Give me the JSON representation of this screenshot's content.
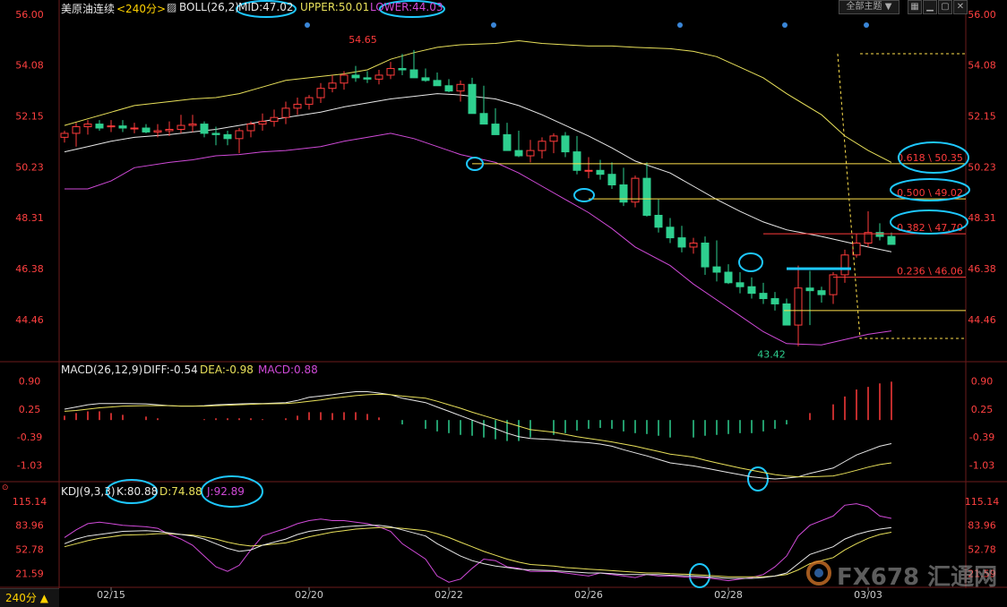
{
  "colors": {
    "bg": "#000000",
    "up": "#ff3b3b",
    "down": "#2ecf8f",
    "price_axis": "#ff4040",
    "mid": "#e8e8e8",
    "upper": "#e8e05a",
    "lower": "#d04ad8",
    "fib": "#ffe14d",
    "highlight": "#1ec8ff",
    "neutral_axis": "#cccccc"
  },
  "header": {
    "instrument": "美原油连续",
    "timeframe": "<240分>",
    "indicator": "BOLL(26,2)",
    "mid_label": "MID:47.02",
    "upper_label": "UPPER:50.01",
    "lower_label": "LOWER:44.03"
  },
  "toolbar": {
    "theme_label": "全部主题",
    "theme_arrow": "▼"
  },
  "timeframe_button": "240分 ▲",
  "watermark": "FX678 汇通网",
  "chart_data": [
    {
      "type": "candlestick",
      "panel": "price",
      "ylim": [
        43.0,
        56.0
      ],
      "y_ticks": [
        "56.00",
        "54.08",
        "52.15",
        "50.23",
        "48.31",
        "46.38",
        "44.46"
      ],
      "x_tick_labels": [
        "02/15",
        "02/20",
        "02/22",
        "02/26",
        "02/28",
        "03/03"
      ],
      "x_tick_index": [
        4,
        21,
        33,
        45,
        57,
        69
      ],
      "bar_count": 72,
      "candles": {
        "open": [
          51.35,
          51.5,
          51.75,
          51.85,
          51.75,
          51.78,
          51.7,
          51.7,
          51.55,
          51.6,
          51.65,
          51.8,
          51.85,
          51.5,
          51.45,
          51.3,
          51.6,
          51.85,
          51.95,
          52.1,
          52.45,
          52.6,
          52.85,
          53.2,
          53.4,
          53.7,
          53.6,
          53.55,
          53.7,
          53.95,
          53.9,
          53.6,
          53.5,
          53.3,
          53.1,
          53.35,
          52.25,
          51.85,
          51.45,
          50.85,
          50.65,
          50.85,
          51.2,
          51.4,
          50.8,
          50.1,
          50.1,
          49.95,
          49.55,
          48.9,
          49.8,
          48.4,
          47.95,
          47.55,
          47.2,
          47.35,
          46.45,
          46.25,
          45.85,
          45.7,
          45.45,
          45.25,
          45.05,
          44.25,
          45.65,
          45.55,
          45.4,
          46.15,
          46.9,
          47.35,
          47.75,
          47.6
        ],
        "high": [
          51.6,
          51.9,
          52.0,
          52.0,
          52.0,
          52.0,
          51.9,
          51.85,
          51.85,
          51.95,
          52.2,
          52.2,
          51.95,
          51.75,
          51.6,
          51.7,
          51.95,
          52.25,
          52.4,
          52.7,
          52.85,
          52.95,
          53.4,
          53.7,
          53.85,
          54.05,
          53.85,
          53.9,
          54.2,
          54.5,
          54.65,
          53.95,
          53.8,
          53.55,
          53.5,
          53.6,
          53.3,
          52.45,
          51.9,
          51.6,
          51.25,
          51.35,
          51.5,
          51.55,
          51.4,
          50.6,
          50.5,
          50.4,
          50.2,
          49.9,
          50.4,
          49.0,
          48.3,
          48.0,
          47.55,
          47.6,
          47.45,
          46.55,
          46.25,
          46.05,
          45.85,
          45.5,
          45.25,
          46.5,
          46.3,
          45.7,
          46.25,
          47.1,
          47.7,
          48.55,
          48.1,
          47.75
        ],
        "low": [
          51.15,
          51.0,
          51.45,
          51.6,
          51.55,
          51.55,
          51.5,
          51.5,
          51.35,
          51.4,
          51.5,
          51.55,
          51.35,
          51.05,
          51.05,
          50.75,
          51.35,
          51.6,
          51.75,
          51.85,
          52.2,
          52.4,
          52.65,
          53.05,
          53.15,
          53.45,
          53.4,
          53.35,
          53.55,
          53.7,
          53.75,
          53.45,
          53.3,
          53.05,
          52.7,
          52.85,
          52.15,
          51.6,
          51.15,
          50.6,
          50.4,
          50.55,
          50.75,
          50.6,
          49.95,
          49.8,
          49.75,
          49.4,
          48.75,
          48.7,
          48.35,
          47.75,
          47.35,
          47.0,
          46.95,
          46.15,
          45.9,
          45.8,
          45.45,
          45.25,
          45.05,
          44.8,
          44.6,
          43.45,
          44.25,
          45.1,
          45.05,
          45.85,
          46.8,
          47.2,
          47.45,
          47.3
        ],
        "close": [
          51.5,
          51.75,
          51.85,
          51.7,
          51.78,
          51.7,
          51.7,
          51.55,
          51.6,
          51.65,
          51.8,
          51.85,
          51.5,
          51.45,
          51.3,
          51.6,
          51.85,
          51.95,
          52.1,
          52.45,
          52.6,
          52.85,
          53.2,
          53.4,
          53.7,
          53.6,
          53.55,
          53.7,
          53.95,
          53.9,
          53.6,
          53.5,
          53.3,
          53.1,
          53.35,
          52.25,
          51.85,
          51.45,
          50.85,
          50.65,
          50.85,
          51.2,
          51.4,
          50.8,
          50.1,
          50.1,
          49.95,
          49.55,
          48.9,
          49.8,
          48.4,
          47.95,
          47.55,
          47.2,
          47.35,
          46.45,
          46.25,
          45.85,
          45.7,
          45.45,
          45.25,
          45.05,
          44.25,
          45.65,
          45.55,
          45.4,
          46.15,
          46.9,
          47.35,
          47.75,
          47.6,
          47.3
        ]
      },
      "bands": {
        "upper_start": [
          51.8,
          52.05,
          52.3,
          52.55,
          52.7,
          52.8,
          52.85,
          53.0,
          53.25,
          53.5,
          53.65,
          53.75,
          53.9,
          54.3,
          54.55,
          54.75,
          54.85,
          54.9,
          55.0,
          54.9,
          54.85,
          54.8,
          54.8,
          54.75,
          54.7,
          54.6,
          54.4,
          54.0,
          53.6,
          53.0,
          52.2,
          51.4,
          50.85,
          50.4
        ],
        "mid": [
          50.8,
          51.0,
          51.2,
          51.35,
          51.45,
          51.55,
          51.65,
          51.8,
          51.95,
          52.1,
          52.3,
          52.5,
          52.65,
          52.8,
          52.9,
          53.0,
          52.95,
          52.8,
          52.55,
          52.2,
          51.8,
          51.4,
          50.95,
          50.45,
          50.0,
          49.5,
          49.0,
          48.55,
          48.15,
          47.85,
          47.6,
          47.4,
          47.2,
          47.02
        ],
        "lower": [
          49.4,
          49.4,
          49.7,
          50.2,
          50.4,
          50.5,
          50.65,
          50.7,
          50.8,
          50.85,
          51.0,
          51.2,
          51.35,
          51.5,
          51.3,
          51.0,
          50.7,
          50.4,
          50.0,
          49.5,
          49.0,
          48.5,
          47.9,
          47.2,
          46.5,
          45.8,
          45.2,
          44.6,
          44.0,
          43.55,
          43.5,
          43.7,
          43.9,
          44.03
        ]
      },
      "annotations": {
        "high_label": "54.65",
        "high_value": 54.65,
        "low_label": "43.42",
        "low_value": 43.42,
        "fib_levels": [
          {
            "label": "0.618 \\ 50.35",
            "value": 50.35
          },
          {
            "label": "0.500 \\ 49.02",
            "value": 49.02
          },
          {
            "label": "0.382 \\ 47.70",
            "value": 47.7
          },
          {
            "label": "0.236 \\ 46.06",
            "value": 46.06
          }
        ],
        "support_line": 46.38,
        "lower_line": 44.8
      }
    },
    {
      "type": "macd",
      "panel": "macd",
      "title": "MACD(26,12,9)",
      "diff_label": "DIFF:-0.54",
      "dea_label": "DEA:-0.98",
      "macd_label": "MACD:0.88",
      "ylim": [
        -1.35,
        1.05
      ],
      "y_ticks": [
        "0.90",
        "0.25",
        "-0.39",
        "-1.03"
      ],
      "diff": [
        0.25,
        0.3,
        0.35,
        0.38,
        0.38,
        0.38,
        0.37,
        0.35,
        0.33,
        0.32,
        0.32,
        0.33,
        0.35,
        0.36,
        0.37,
        0.38,
        0.38,
        0.4,
        0.45,
        0.52,
        0.55,
        0.58,
        0.62,
        0.65,
        0.65,
        0.62,
        0.58,
        0.5,
        0.4,
        0.3,
        0.2,
        0.1,
        0.0,
        -0.1,
        -0.2,
        -0.3,
        -0.38,
        -0.42,
        -0.45,
        -0.48,
        -0.5,
        -0.52,
        -0.55,
        -0.6,
        -0.68,
        -0.75,
        -0.82,
        -0.9,
        -0.98,
        -1.05,
        -1.1,
        -1.15,
        -1.2,
        -1.25,
        -1.3,
        -1.33,
        -1.35,
        -1.33,
        -1.3,
        -1.22,
        -1.1,
        -0.95,
        -0.8,
        -0.7,
        -0.6,
        -0.54
      ],
      "dea": [
        0.2,
        0.22,
        0.25,
        0.28,
        0.3,
        0.32,
        0.33,
        0.33,
        0.33,
        0.32,
        0.32,
        0.32,
        0.33,
        0.34,
        0.35,
        0.36,
        0.37,
        0.38,
        0.4,
        0.43,
        0.46,
        0.5,
        0.53,
        0.56,
        0.58,
        0.59,
        0.58,
        0.55,
        0.5,
        0.43,
        0.35,
        0.27,
        0.18,
        0.1,
        0.02,
        -0.06,
        -0.14,
        -0.22,
        -0.28,
        -0.33,
        -0.38,
        -0.42,
        -0.46,
        -0.5,
        -0.55,
        -0.6,
        -0.66,
        -0.72,
        -0.78,
        -0.85,
        -0.92,
        -0.98,
        -1.04,
        -1.1,
        -1.15,
        -1.2,
        -1.25,
        -1.28,
        -1.3,
        -1.3,
        -1.28,
        -1.22,
        -1.15,
        -1.08,
        -1.02,
        -0.98
      ]
    },
    {
      "type": "kdj",
      "panel": "kdj",
      "title": "KDJ(9,3,3)",
      "k_label": "K:80.88",
      "d_label": "D:74.88",
      "j_label": "J:92.89",
      "ylim": [
        8.0,
        122.0
      ],
      "y_ticks": [
        "115.14",
        "83.96",
        "52.78",
        "21.59"
      ],
      "k": [
        60,
        66,
        70,
        72,
        74,
        76,
        77,
        76,
        74,
        72,
        70,
        66,
        60,
        54,
        50,
        52,
        58,
        66,
        72,
        76,
        78,
        80,
        82,
        83,
        84,
        84,
        82,
        78,
        70,
        60,
        52,
        44,
        38,
        34,
        31,
        29,
        27,
        26,
        25,
        24,
        23,
        22,
        22,
        21,
        20,
        20,
        20,
        20,
        19,
        18,
        17,
        16,
        15,
        15,
        15,
        16,
        18,
        22,
        34,
        46,
        56,
        66,
        72,
        76,
        79,
        80.88
      ],
      "d": [
        56,
        60,
        64,
        67,
        69,
        71,
        72,
        73,
        73,
        72,
        71,
        69,
        66,
        62,
        59,
        57,
        58,
        61,
        65,
        69,
        72,
        75,
        77,
        79,
        80,
        81,
        81,
        80,
        77,
        73,
        68,
        62,
        56,
        50,
        45,
        40,
        36,
        33,
        31,
        29,
        28,
        27,
        26,
        25,
        24,
        23,
        22,
        22,
        21,
        20,
        19,
        18,
        17,
        17,
        17,
        17,
        18,
        20,
        26,
        34,
        42,
        52,
        60,
        67,
        72,
        74.88
      ],
      "j": [
        68,
        78,
        86,
        88,
        86,
        84,
        82,
        80,
        72,
        66,
        58,
        44,
        30,
        24,
        32,
        52,
        70,
        80,
        86,
        90,
        92,
        90,
        90,
        88,
        86,
        82,
        76,
        60,
        40,
        18,
        10,
        14,
        28,
        40,
        38,
        30,
        28,
        24,
        24,
        22,
        20,
        18,
        22,
        20,
        18,
        16,
        20,
        18,
        18,
        16,
        16,
        14,
        12,
        14,
        16,
        20,
        30,
        44,
        70,
        84,
        96,
        110,
        112,
        108,
        96,
        92.89
      ]
    }
  ]
}
